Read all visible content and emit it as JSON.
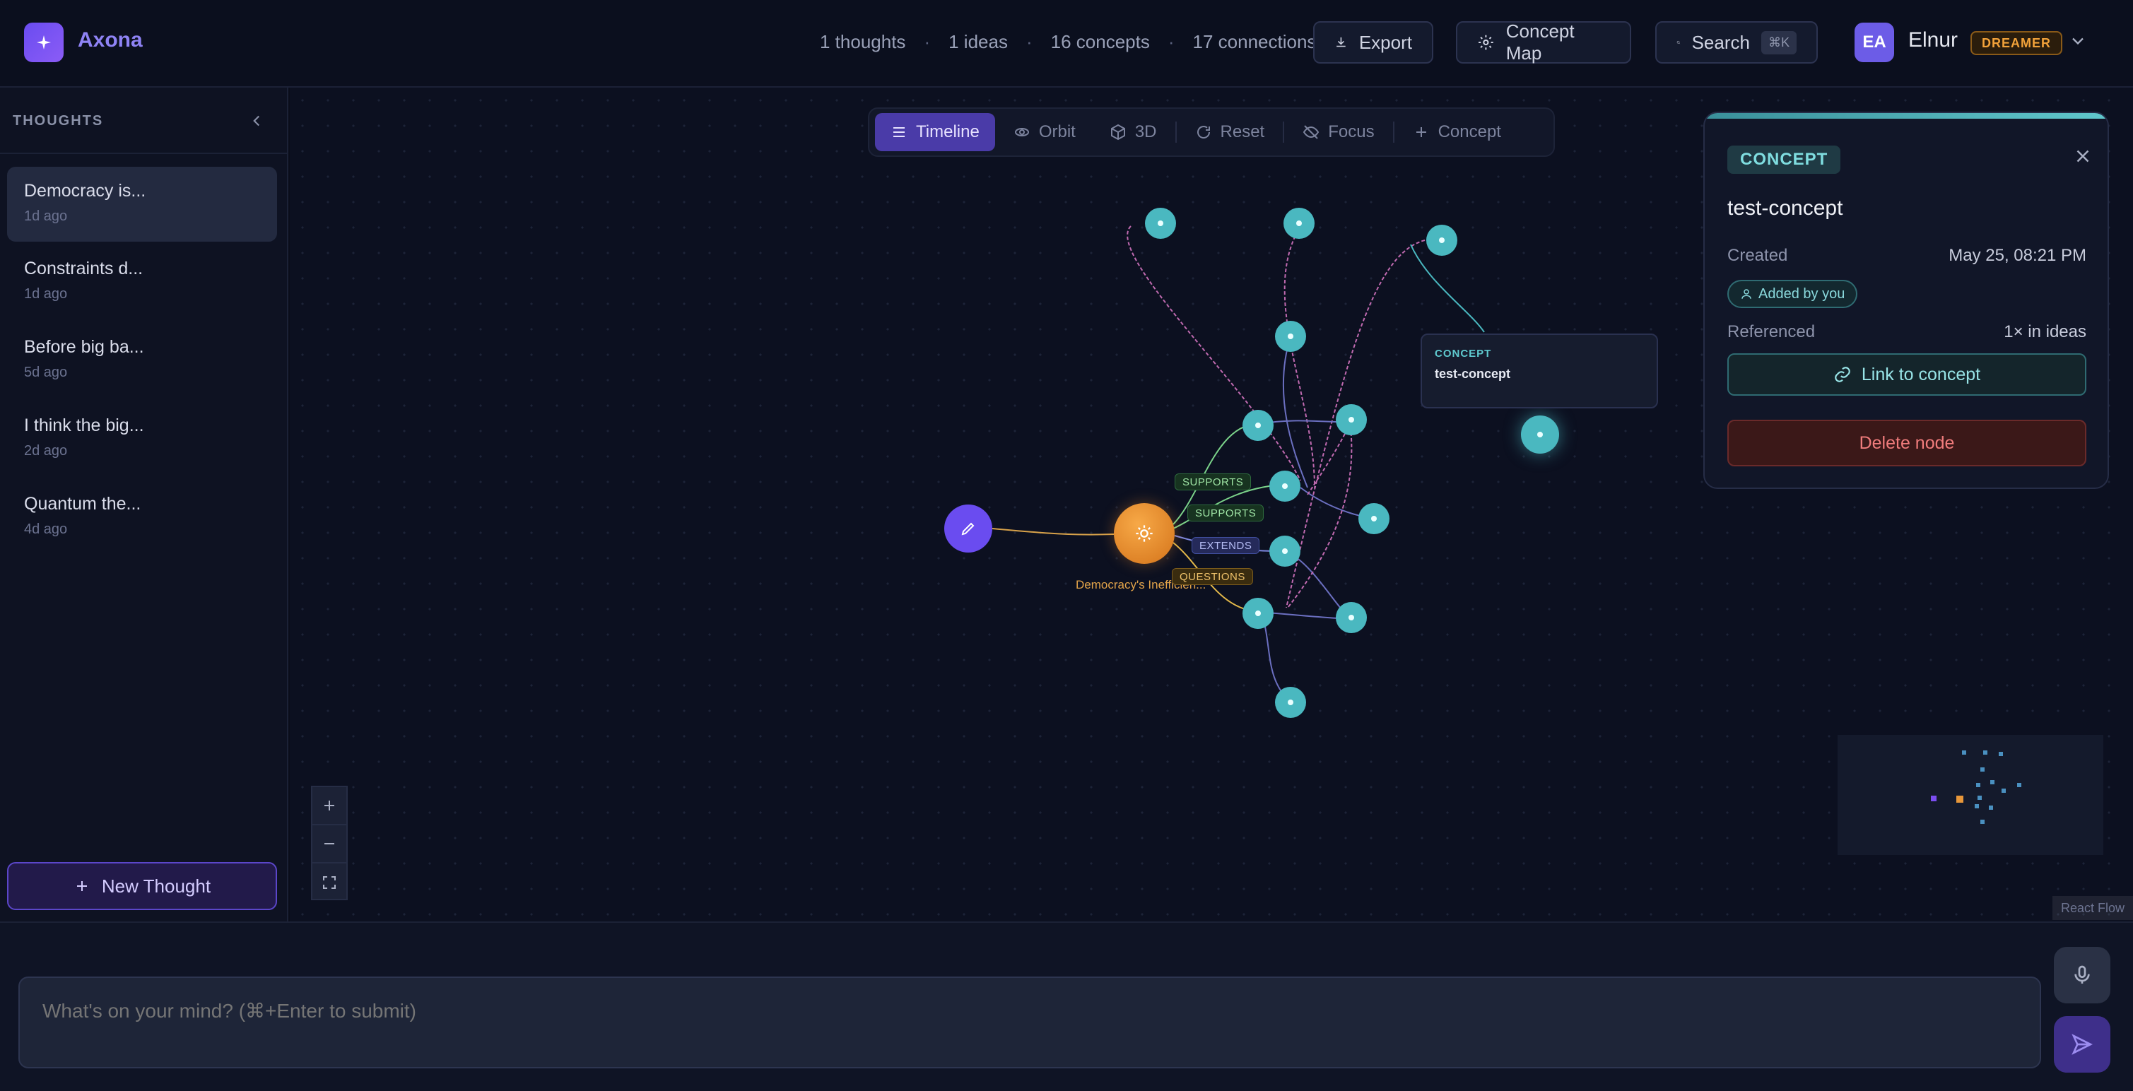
{
  "app": {
    "name": "Axona",
    "logo_icon": "sparkle-icon"
  },
  "stats": {
    "thoughts": "1 thoughts",
    "ideas": "1 ideas",
    "concepts": "16 concepts",
    "connections": "17 connections"
  },
  "header": {
    "export_label": "Export",
    "concept_map_label": "Concept Map",
    "search_label": "Search",
    "search_shortcut": "⌘K",
    "user_initials": "EA",
    "user_name": "Elnur",
    "user_badge": "DREAMER"
  },
  "sidebar": {
    "title": "THOUGHTS",
    "items": [
      {
        "title": "Democracy is...",
        "time": "1d ago"
      },
      {
        "title": "Constraints d...",
        "time": "1d ago"
      },
      {
        "title": "Before big ba...",
        "time": "5d ago"
      },
      {
        "title": "I think the big...",
        "time": "2d ago"
      },
      {
        "title": "Quantum the...",
        "time": "4d ago"
      }
    ],
    "new_thought_label": "New Thought"
  },
  "toolbar": {
    "items": [
      {
        "label": "Timeline",
        "icon": "list-icon"
      },
      {
        "label": "Orbit",
        "icon": "orbit-icon"
      },
      {
        "label": "3D",
        "icon": "cube-icon"
      },
      {
        "label": "Reset",
        "icon": "refresh-icon"
      },
      {
        "label": "Focus",
        "icon": "eye-off-icon"
      },
      {
        "label": "Concept",
        "icon": "plus-icon"
      }
    ],
    "active": "Timeline"
  },
  "graph": {
    "idea_label": "Democracy's Inefficien...",
    "edge_labels": [
      "SUPPORTS",
      "SUPPORTS",
      "EXTENDS",
      "QUESTIONS"
    ],
    "tooltip": {
      "type": "CONCEPT",
      "name": "test-concept"
    },
    "attribution": "React Flow"
  },
  "panel": {
    "badge": "CONCEPT",
    "name": "test-concept",
    "created_label": "Created",
    "created_value": "May 25, 08:21 PM",
    "added_by": "Added by you",
    "referenced_label": "Referenced",
    "referenced_value": "1× in ideas",
    "link_label": "Link to concept",
    "delete_label": "Delete node"
  },
  "input": {
    "placeholder": "What's on your mind? (⌘+Enter to submit)"
  },
  "colors": {
    "accent": "#6a4cf0",
    "concept": "#4ab8c0",
    "idea": "#f0a040",
    "danger": "#f07c7c"
  }
}
